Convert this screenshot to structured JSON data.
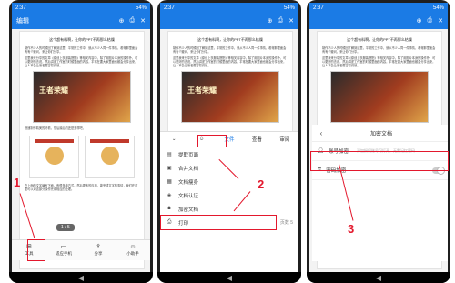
{
  "phone1": {
    "time": "2:37",
    "battery": "54%",
    "title": "编辑",
    "doc_title": "这个超有料啊，让你的PPT不再那么枯燥",
    "doc_para1": "制作不少人的时候回了解到这里，平常的工作中，就从不少人同一件事情，看得那里面会有有个疑问，来让你们分享。",
    "doc_para2": "这里我来分享的文章《原创上衣服装搭配》等相关内容中，除了用图片本身的操作外，可以更好的去说，然后讲述工作室的时候里面的内容，平常在要大家里面也都会分享出来，让人不会让读者更容易阅读。",
    "image_caption": "王者荣耀",
    "doc_para3": "快速制作精美的好看，然后最后的还是多样吧，",
    "page_badge": "1 / 5",
    "doc_para4": "在上面的文字编写下面，有很多种方式，然后更多的应用，能完成文字的事情，我们在这里可以对这部分操作完成相应的处理。",
    "bottom_items": [
      "工具",
      "适应手机",
      "分享",
      "小助手"
    ],
    "marker": "1"
  },
  "phone2": {
    "time": "2:37",
    "battery": "54%",
    "tabs": [
      "文件",
      "查看",
      "审阅"
    ],
    "menu": [
      {
        "label": "提取页面",
        "icon": "extract-icon"
      },
      {
        "label": "合并文档",
        "icon": "merge-icon"
      },
      {
        "label": "文档瘦身",
        "icon": "slim-icon"
      },
      {
        "label": "文档认证",
        "icon": "certify-icon"
      },
      {
        "label": "加密文档",
        "icon": "lock-icon"
      },
      {
        "label": "打印",
        "icon": "print-icon",
        "value": "页数 5"
      }
    ],
    "marker": "2"
  },
  "phone3": {
    "time": "2:37",
    "battery": "54%",
    "title": "加密文档",
    "rows": [
      {
        "label": "账号加密",
        "placeholder": "添加授权账号可打开，无需记忆密码"
      },
      {
        "label": "密码加密"
      }
    ],
    "marker": "3"
  },
  "colors": {
    "accent": "#1b7be5",
    "marker": "#e3182d"
  }
}
